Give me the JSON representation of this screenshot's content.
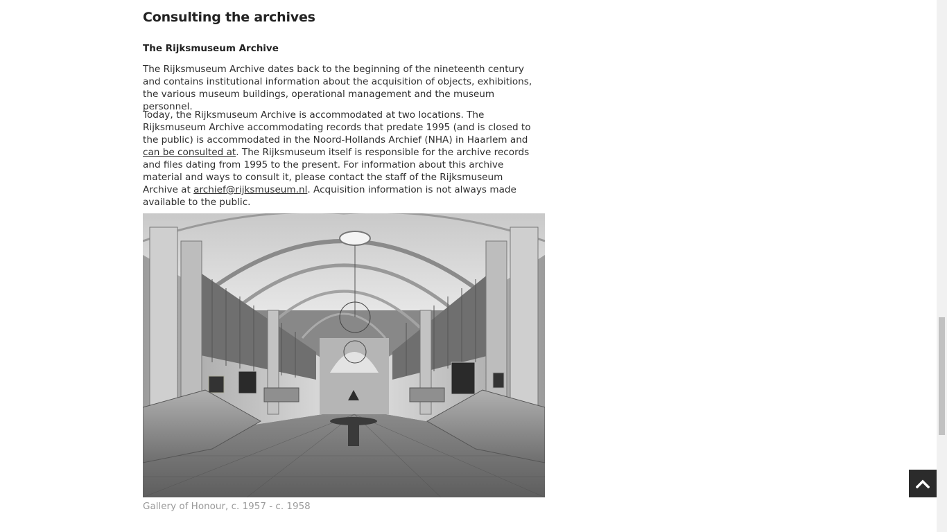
{
  "section": {
    "title": "Consulting the archives",
    "subtitle": "The Rijksmuseum Archive"
  },
  "paragraph1": {
    "text": "The Rijksmuseum Archive dates back to the beginning of the nineteenth century and contains institutional information about the acquisition of objects, exhibitions, the various museum buildings, operational management and the museum personnel."
  },
  "paragraph2": {
    "part1": "Today, the Rijksmuseum Archive is accommodated at two locations. The Rijksmuseum Archive accommodating records that predate 1995 (and is closed to the public) is accommodated in the Noord-Hollands Archief (NHA) in Haarlem and ",
    "link1": "can be consulted at",
    "part2": ". The Rijksmuseum itself is responsible for the archive records and files dating from 1995 to the present. For information about this archive material and ways to consult it, please contact the staff of the Rijksmuseum Archive at ",
    "link2": "archief@rijksmuseum.nl",
    "part3": ". Acquisition information is not always made available to the public."
  },
  "figure": {
    "caption": "Gallery of Honour, c. 1957 - c. 1958",
    "alt": "Gallery of Honour, c. 1957 - c. 1958"
  },
  "controls": {
    "back_to_top_icon": "chevron-up-icon"
  },
  "colors": {
    "text": "#2e2e2e",
    "caption": "#9a9a9a",
    "back_to_top_bg": "#2b2b2b"
  }
}
